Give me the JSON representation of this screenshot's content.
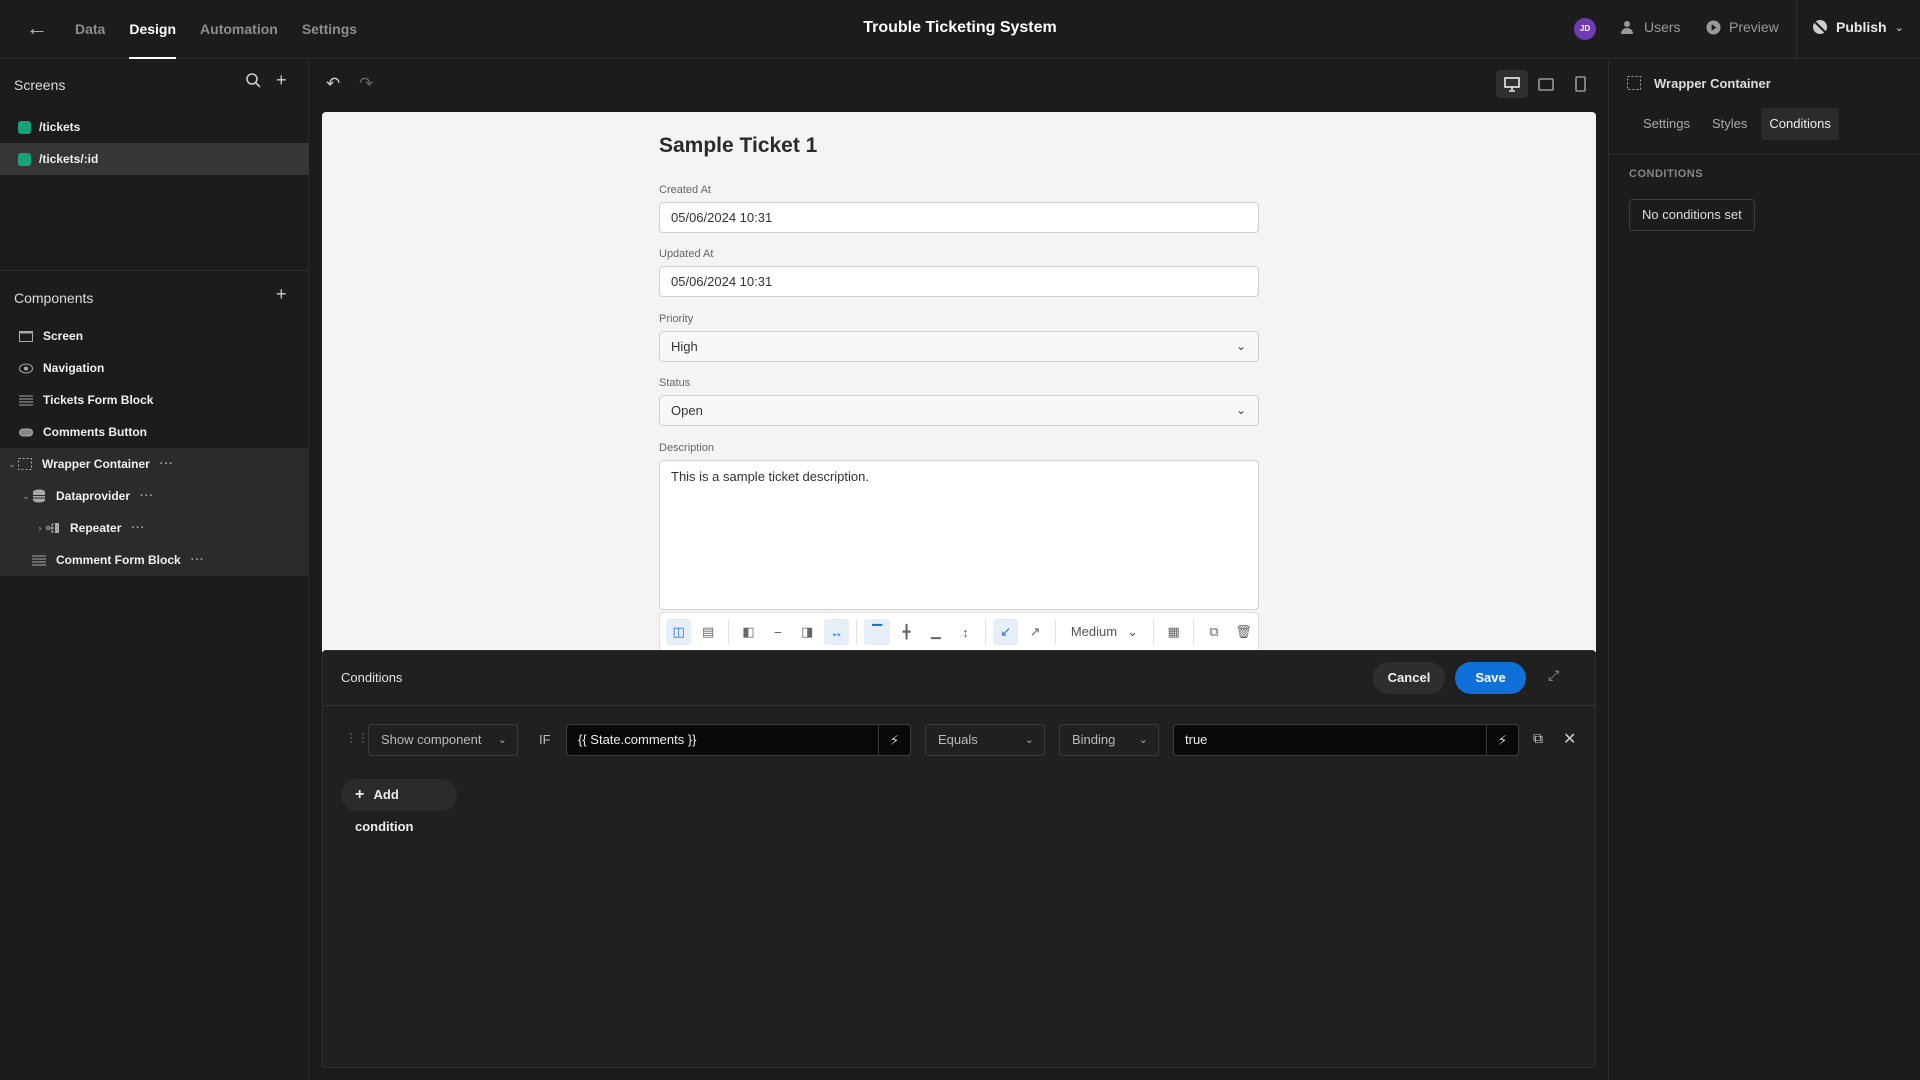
{
  "header": {
    "back_icon": "arrow-left-icon",
    "tabs": [
      {
        "label": "Data",
        "active": false
      },
      {
        "label": "Design",
        "active": true
      },
      {
        "label": "Automation",
        "active": false
      },
      {
        "label": "Settings",
        "active": false
      }
    ],
    "app_title": "Trouble Ticketing System",
    "avatar_initials": "JD",
    "avatar_color": "#6e3bb5",
    "users_label": "Users",
    "preview_label": "Preview",
    "publish_label": "Publish"
  },
  "screens": {
    "title": "Screens",
    "items": [
      {
        "label": "/tickets",
        "selected": false,
        "color": "#15a37e"
      },
      {
        "label": "/tickets/:id",
        "selected": true,
        "color": "#15a37e"
      }
    ]
  },
  "components": {
    "title": "Components",
    "items": [
      {
        "label": "Screen",
        "icon": "screen-icon",
        "level": 0
      },
      {
        "label": "Navigation",
        "icon": "eye-icon",
        "level": 0
      },
      {
        "label": "Tickets Form Block",
        "icon": "form-block-icon",
        "level": 0
      },
      {
        "label": "Comments Button",
        "icon": "button-icon",
        "level": 0
      },
      {
        "label": "Wrapper Container",
        "icon": "container-icon",
        "level": 0,
        "selected": true,
        "expanded": true
      },
      {
        "label": "Dataprovider",
        "icon": "database-icon",
        "level": 1,
        "expanded": true
      },
      {
        "label": "Repeater",
        "icon": "repeater-icon",
        "level": 2,
        "expanded": false
      },
      {
        "label": "Comment Form Block",
        "icon": "form-block-icon",
        "level": 1
      }
    ]
  },
  "preview": {
    "title": "Sample Ticket 1",
    "fields": [
      {
        "label": "Created At",
        "value": "05/06/2024 10:31",
        "type": "text"
      },
      {
        "label": "Updated At",
        "value": "05/06/2024 10:31",
        "type": "text"
      },
      {
        "label": "Priority",
        "value": "High",
        "type": "select"
      },
      {
        "label": "Status",
        "value": "Open",
        "type": "select"
      },
      {
        "label": "Description",
        "value": "This is a sample ticket description.",
        "type": "textarea"
      }
    ],
    "toolbar": {
      "size_label": "Medium"
    }
  },
  "conditions_modal": {
    "title": "Conditions",
    "cancel_label": "Cancel",
    "save_label": "Save",
    "save_color": "#0f70d8",
    "row": {
      "action": "Show component",
      "if_label": "IF",
      "left_value": "{{ State.comments }}",
      "operator": "Equals",
      "type": "Binding",
      "right_value": "true"
    },
    "add_label": "Add condition"
  },
  "right_panel": {
    "component_name": "Wrapper Container",
    "tabs": [
      {
        "label": "Settings",
        "selected": false
      },
      {
        "label": "Styles",
        "selected": false
      },
      {
        "label": "Conditions",
        "selected": true
      }
    ],
    "section_title": "CONDITIONS",
    "no_conditions_label": "No conditions set"
  }
}
